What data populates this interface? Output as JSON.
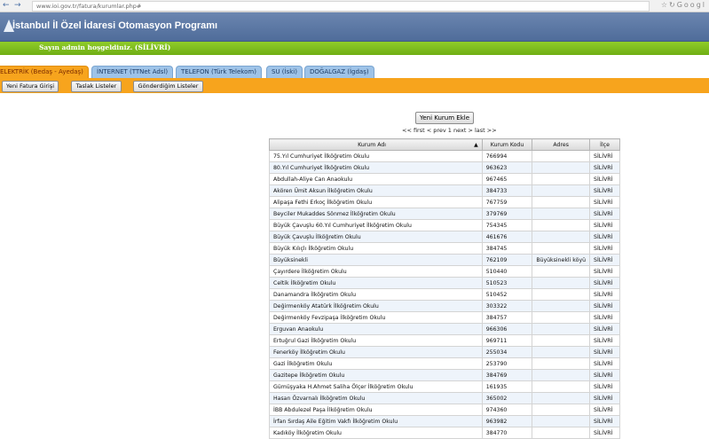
{
  "browser": {
    "url": "www.ioi.gov.tr/fatura/kurumlar.php#",
    "search_hint": "Googl"
  },
  "app": {
    "title": "İstanbul İl Özel İdaresi Otomasyon Programı",
    "welcome": "Sayın admin hoşgeldiniz. (SİLİVRİ)"
  },
  "tabs": [
    {
      "label": "ELEKTRİK (Bedaş - Ayedaş)",
      "active": true
    },
    {
      "label": "İNTERNET (TTNet Adsl)",
      "active": false
    },
    {
      "label": "TELEFON (Türk Telekom)",
      "active": false
    },
    {
      "label": "SU (İski)",
      "active": false
    },
    {
      "label": "DOĞALGAZ (İgdaş)",
      "active": false
    }
  ],
  "toolbar": {
    "new_invoice": "Yeni Fatura Girişi",
    "draft_lists": "Taslak Listeler",
    "sent_lists": "Gönderdiğim Listeler"
  },
  "main": {
    "add_institution": "Yeni Kurum Ekle",
    "pager": "<< first < prev 1 next > last >>"
  },
  "table": {
    "headers": [
      "Kurum Adı",
      "Kurum Kodu",
      "Adres",
      "İlçe"
    ],
    "rows": [
      [
        "75.Yıl Cumhuriyet İlköğretim Okulu",
        "766994",
        "",
        "SİLİVRİ"
      ],
      [
        "80.Yıl Cumhuriyet İlköğretim Okulu",
        "963623",
        "",
        "SİLİVRİ"
      ],
      [
        "Abdullah-Aliye Can Anaokulu",
        "967465",
        "",
        "SİLİVRİ"
      ],
      [
        "Akören Ümit Aksun İlköğretim Okulu",
        "384733",
        "",
        "SİLİVRİ"
      ],
      [
        "Alipaşa Fethi Erkoç İlköğretim Okulu",
        "767759",
        "",
        "SİLİVRİ"
      ],
      [
        "Beyciler Mukaddes Sönmez İlköğretim Okulu",
        "379769",
        "",
        "SİLİVRİ"
      ],
      [
        "Büyük Çavuşlu 60.Yıl Cumhuriyet İlköğretim Okulu",
        "754345",
        "",
        "SİLİVRİ"
      ],
      [
        "Büyük Çavuşlu İlköğretim Okulu",
        "461676",
        "",
        "SİLİVRİ"
      ],
      [
        "Büyük Kılıçlı İlköğretim Okulu",
        "384745",
        "",
        "SİLİVRİ"
      ],
      [
        "Büyüksinekli",
        "762109",
        "Büyüksinekli köyü",
        "SİLİVRİ"
      ],
      [
        "Çayırdere İlköğretim Okulu",
        "510440",
        "",
        "SİLİVRİ"
      ],
      [
        "Celtik İlköğretim Okulu",
        "510523",
        "",
        "SİLİVRİ"
      ],
      [
        "Danamandra İlköğretim Okulu",
        "510452",
        "",
        "SİLİVRİ"
      ],
      [
        "Değirmenköy Atatürk İlköğretim Okulu",
        "303322",
        "",
        "SİLİVRİ"
      ],
      [
        "Değirmenköy Fevzipaşa İlköğretim Okulu",
        "384757",
        "",
        "SİLİVRİ"
      ],
      [
        "Erguvan Anaokulu",
        "966306",
        "",
        "SİLİVRİ"
      ],
      [
        "Ertuğrul Gazi İlköğretim Okulu",
        "969711",
        "",
        "SİLİVRİ"
      ],
      [
        "Fenerköy İlköğretim Okulu",
        "255034",
        "",
        "SİLİVRİ"
      ],
      [
        "Gazi İlköğretim Okulu",
        "253790",
        "",
        "SİLİVRİ"
      ],
      [
        "Gazitepe İlköğretim Okulu",
        "384769",
        "",
        "SİLİVRİ"
      ],
      [
        "Gümüşyaka H.Ahmet Saliha Ölçer İlköğretim Okulu",
        "161935",
        "",
        "SİLİVRİ"
      ],
      [
        "Hasan Özvarnalı İlköğretim Okulu",
        "365002",
        "",
        "SİLİVRİ"
      ],
      [
        "İBB Abdulezel Paşa İlköğretim Okulu",
        "974360",
        "",
        "SİLİVRİ"
      ],
      [
        "İrfan Sırdaş Aile Eğitim Vakfı İlköğretim Okulu",
        "963982",
        "",
        "SİLİVRİ"
      ],
      [
        "Kadıköy İlköğretim Okulu",
        "384770",
        "",
        "SİLİVRİ"
      ]
    ]
  }
}
